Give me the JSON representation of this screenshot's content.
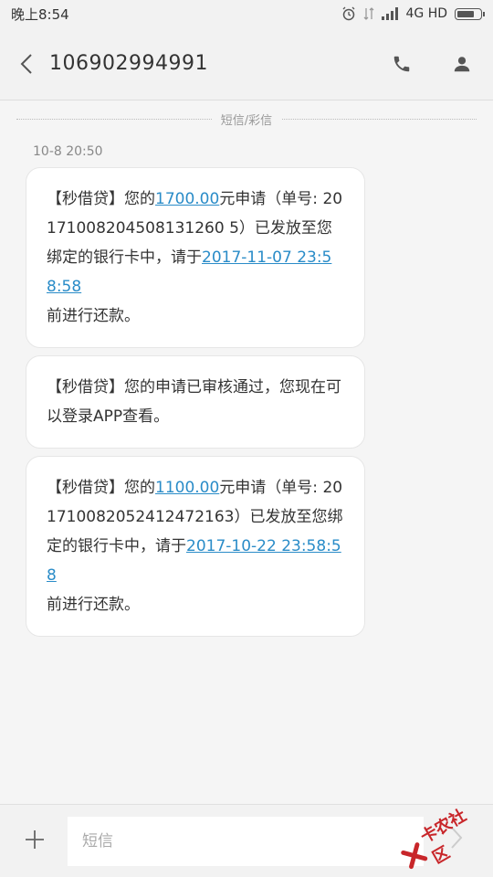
{
  "status": {
    "time": "晚上8:54",
    "network": "4G HD"
  },
  "header": {
    "title": "106902994991"
  },
  "divider_label": "短信/彩信",
  "timestamp": "10-8 20:50",
  "messages": [
    {
      "p1": "【秒借贷】您的",
      "amount": "1700.00",
      "p2": "元申请（单号: 20171008204508131260 5）已发放至您绑定的银行卡中，请于",
      "date": "2017-11-07 23:58:58",
      "p3": "前进行还款。"
    },
    {
      "text": "【秒借贷】您的申请已审核通过，您现在可以登录APP查看。"
    },
    {
      "p1": "【秒借贷】您的",
      "amount": "1100.00",
      "p2": "元申请（单号: 201710082052412472163）已发放至您绑定的银行卡中，请于",
      "date": "2017-10-22 23:58:58",
      "p3": "前进行还款。"
    }
  ],
  "composer": {
    "placeholder": "短信"
  },
  "watermark": "卡农社区",
  "colors": {
    "link": "#2a8cc8",
    "watermark": "#c8262a"
  }
}
